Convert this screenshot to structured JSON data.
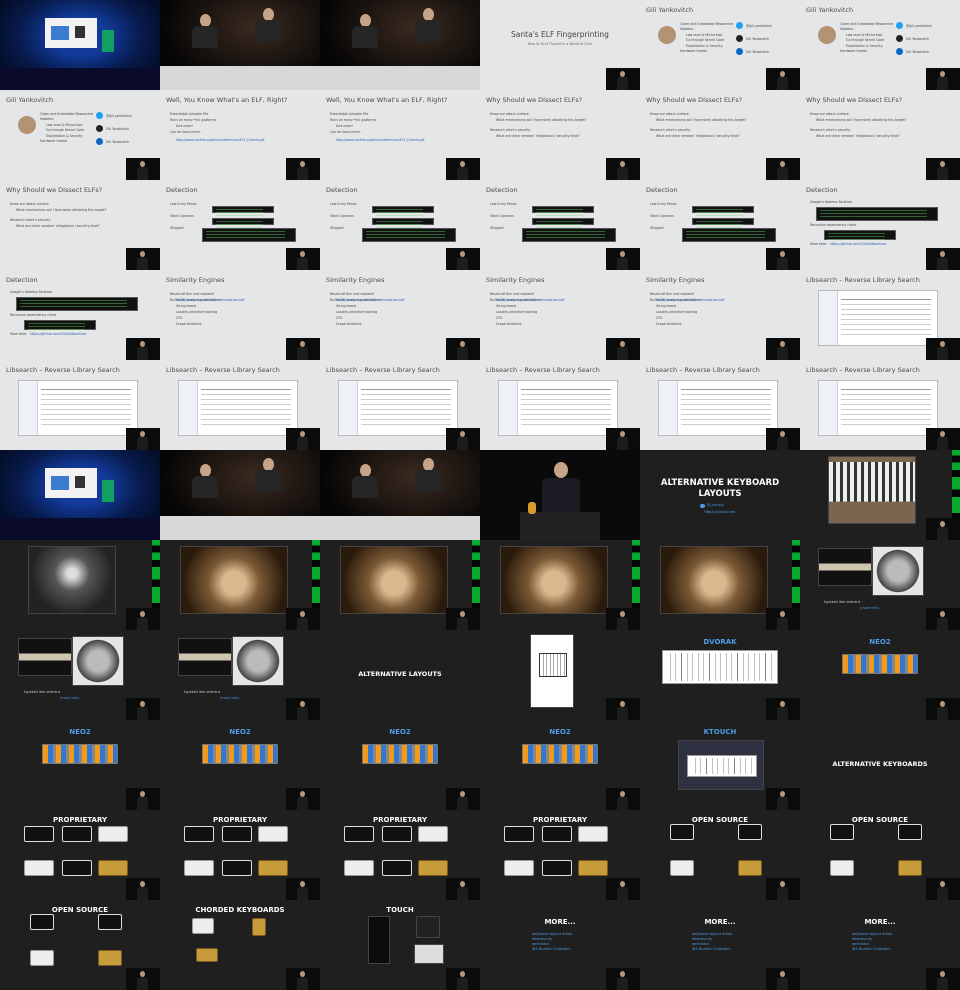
{
  "colors": {
    "link": "#4d9be6",
    "accent_green": "#00cc33",
    "light_slide_bg": "#e5e6e8",
    "dark_slide_bg": "#1f1f1f"
  },
  "slides": [
    {
      "kind": "stage"
    },
    {
      "kind": "panel",
      "people": 2
    },
    {
      "kind": "panel",
      "people": 2
    },
    {
      "kind": "title-light",
      "title": "Santa's ELF Fingerprinting",
      "subtitle": "How to Find Thyself in a World of ELFs"
    },
    {
      "kind": "bio",
      "title": "Gili Yankovitch",
      "bullets": [
        "Cyber and Embedded Researcher",
        "Hobbies:",
        "Low level & Microchips",
        "Go through Kernel Code",
        "Exploitation & Security",
        "Hardware Hacker"
      ],
      "social": [
        "@gili.yankovitch",
        "Gili Yankovitch",
        "Gili Yankovitch"
      ]
    },
    {
      "kind": "bio",
      "title": "Gili Yankovitch",
      "bullets": [
        "Cyber and Embedded Researcher",
        "Hobbies:",
        "Low level & Microchips",
        "Go through Kernel Code",
        "Exploitation & Security",
        "Hardware Hacker"
      ],
      "social": [
        "@gili.yankovitch",
        "Gili Yankovitch",
        "Gili Yankovitch"
      ]
    },
    {
      "kind": "bio",
      "title": "Gili Yankovitch",
      "bullets": [
        "Cyber and Embedded Researcher",
        "Hobbies:",
        "Low level & Microchips",
        "Go through Kernel Code",
        "Exploitation & Security",
        "Hardware Hacker"
      ],
      "social": [
        "@gili.yankovitch",
        "Gili Yankovitch",
        "Gili Yankovitch"
      ]
    },
    {
      "kind": "bullets",
      "title": "Well, You Know What's an ELF, Right?",
      "bullets": [
        "Executable Linkable File",
        "Runs on many *nix platforms",
        "And more!",
        "Can be found here:"
      ],
      "link": "http://www.skyfree.org/linux/references/ELF_Format.pdf"
    },
    {
      "kind": "bullets",
      "title": "Well, You Know What's an ELF, Right?",
      "bullets": [
        "Executable Linkable File",
        "Runs on many *nix platforms",
        "And more!",
        "Can be found here:"
      ],
      "link": "http://www.skyfree.org/linux/references/ELF_Format.pdf"
    },
    {
      "kind": "bullets",
      "title": "Why Should we Dissect ELFs?",
      "bullets": [
        "Know our attack surface",
        "What mechanisms will I face when attacking this target?",
        "Research other's security",
        "What are other vendors' mitigations / security level?"
      ]
    },
    {
      "kind": "bullets",
      "title": "Why Should we Dissect ELFs?",
      "bullets": [
        "Know our attack surface",
        "What mechanisms will I face when attacking this target?",
        "Research other's security",
        "What are other vendors' mitigations / security level?"
      ]
    },
    {
      "kind": "bullets",
      "title": "Why Should we Dissect ELFs?",
      "bullets": [
        "Know our attack surface",
        "What mechanisms will I face when attacking this target?",
        "Research other's security",
        "What are other vendors' mitigations / security level?"
      ]
    },
    {
      "kind": "bullets",
      "title": "Why Should we Dissect ELFs?",
      "bullets": [
        "Know our attack surface",
        "What mechanisms will I face when attacking this target?",
        "Research other's security",
        "What are other vendors' mitigations / security level?"
      ]
    },
    {
      "kind": "detect",
      "title": "Detection",
      "bullets": [
        "Low-Entry Points",
        "Stack Canaries",
        "Stripped"
      ]
    },
    {
      "kind": "detect",
      "title": "Detection",
      "bullets": [
        "Low-Entry Points",
        "Stack Canaries",
        "Stripped"
      ]
    },
    {
      "kind": "detect",
      "title": "Detection",
      "bullets": [
        "Low-Entry Points",
        "Stack Canaries",
        "Stripped"
      ]
    },
    {
      "kind": "detect",
      "title": "Detection",
      "bullets": [
        "Low-Entry Points",
        "Stack Canaries",
        "Stripped"
      ]
    },
    {
      "kind": "asan",
      "title": "Detection",
      "bullets": [
        "Google's Address Sanitizer",
        "Recursive dependency check",
        "More here:"
      ],
      "link": "https://github.com/Gili0/elfsanitizer"
    },
    {
      "kind": "asan",
      "title": "Detection",
      "bullets": [
        "Google's Address Sanitizer",
        "Recursive dependency check",
        "More here:"
      ],
      "link": "https://github.com/Gili0/elfsanitizer"
    },
    {
      "kind": "bullets",
      "title": "Similarity Engines",
      "bullets": [
        "Based off this nice research",
        "Builds DB analyzing similarities",
        "String based",
        "Locality-sensitive hashing",
        "CFG",
        "Graph similarity"
      ],
      "link": "https://www.cs.ucsb.edu/~ebrucker/sdi.pdf"
    },
    {
      "kind": "bullets",
      "title": "Similarity Engines",
      "bullets": [
        "Based off this nice research",
        "Builds DB analyzing similarities",
        "String based",
        "Locality-sensitive hashing",
        "CFG",
        "Graph similarity"
      ],
      "link": "https://www.cs.ucsb.edu/~ebrucker/sdi.pdf"
    },
    {
      "kind": "bullets",
      "title": "Similarity Engines",
      "bullets": [
        "Based off this nice research",
        "Builds DB analyzing similarities",
        "String based",
        "Locality-sensitive hashing",
        "CFG",
        "Graph similarity"
      ],
      "link": "https://www.cs.ucsb.edu/~ebrucker/sdi.pdf"
    },
    {
      "kind": "bullets",
      "title": "Similarity Engines",
      "bullets": [
        "Based off this nice research",
        "Builds DB analyzing similarities",
        "String based",
        "Locality-sensitive hashing",
        "CFG",
        "Graph similarity"
      ],
      "link": "https://www.cs.ucsb.edu/~ebrucker/sdi.pdf"
    },
    {
      "kind": "libsearch",
      "title": "Libsearch – Reverse Library Search"
    },
    {
      "kind": "libsearch",
      "title": "Libsearch – Reverse Library Search"
    },
    {
      "kind": "libsearch",
      "title": "Libsearch – Reverse Library Search"
    },
    {
      "kind": "libsearch",
      "title": "Libsearch – Reverse Library Search"
    },
    {
      "kind": "libsearch",
      "title": "Libsearch – Reverse Library Search"
    },
    {
      "kind": "libsearch",
      "title": "Libsearch – Reverse Library Search"
    },
    {
      "kind": "libsearch",
      "title": "Libsearch – Reverse Library Search"
    },
    {
      "kind": "stage"
    },
    {
      "kind": "panel",
      "people": 2
    },
    {
      "kind": "panel",
      "people": 2
    },
    {
      "kind": "podium"
    },
    {
      "kind": "darktitle",
      "title": "ALTERNATIVE KEYBOARD LAYOUTS",
      "handle": "@_skhalil",
      "link": "https://skhalil.net"
    },
    {
      "kind": "photo",
      "img": "typewriter-keys"
    },
    {
      "kind": "photo",
      "img": "typewriter-top"
    },
    {
      "kind": "photo",
      "img": "sepia"
    },
    {
      "kind": "photo",
      "img": "sepia"
    },
    {
      "kind": "photo",
      "img": "sepia"
    },
    {
      "kind": "photo",
      "img": "sepia"
    },
    {
      "kind": "pair",
      "caption": "typeball ibm selectric",
      "link": "(more info)"
    },
    {
      "kind": "pair",
      "caption": "typeball ibm selectric",
      "link": "(more info)"
    },
    {
      "kind": "pair",
      "caption": "typeball ibm selectric",
      "link": "(more info)"
    },
    {
      "kind": "darkhead",
      "title": "ALTERNATIVE LAYOUTS"
    },
    {
      "kind": "patent"
    },
    {
      "kind": "layout",
      "title": "DVORAK",
      "img": "white"
    },
    {
      "kind": "layout",
      "title": "NEO2",
      "img": "color"
    },
    {
      "kind": "layout",
      "title": "NEO2",
      "img": "color"
    },
    {
      "kind": "layout",
      "title": "NEO2",
      "img": "color"
    },
    {
      "kind": "layout",
      "title": "NEO2",
      "img": "color"
    },
    {
      "kind": "layout",
      "title": "NEO2",
      "img": "color"
    },
    {
      "kind": "ktouch",
      "title": "KTOUCH"
    },
    {
      "kind": "darkhead",
      "title": "ALTERNATIVE KEYBOARDS"
    },
    {
      "kind": "proprietary",
      "title": "PROPRIETARY"
    },
    {
      "kind": "proprietary",
      "title": "PROPRIETARY"
    },
    {
      "kind": "proprietary",
      "title": "PROPRIETARY"
    },
    {
      "kind": "proprietary",
      "title": "PROPRIETARY"
    },
    {
      "kind": "opensource",
      "title": "OPEN SOURCE"
    },
    {
      "kind": "opensource",
      "title": "OPEN SOURCE"
    },
    {
      "kind": "opensource",
      "title": "OPEN SOURCE"
    },
    {
      "kind": "chorded",
      "title": "CHORDED KEYBOARDS"
    },
    {
      "kind": "touch",
      "title": "TOUCH"
    },
    {
      "kind": "more",
      "title": "MORE...",
      "items": [
        "keyboard layout editor",
        "deskthority",
        "geekhack",
        "IBS Burden Collection"
      ]
    },
    {
      "kind": "more",
      "title": "MORE...",
      "items": [
        "keyboard layout editor",
        "deskthority",
        "geekhack",
        "IBS Burden Collection"
      ]
    },
    {
      "kind": "more",
      "title": "MORE...",
      "items": [
        "keyboard layout editor",
        "deskthority",
        "geekhack",
        "IBS Burden Collection"
      ]
    }
  ]
}
